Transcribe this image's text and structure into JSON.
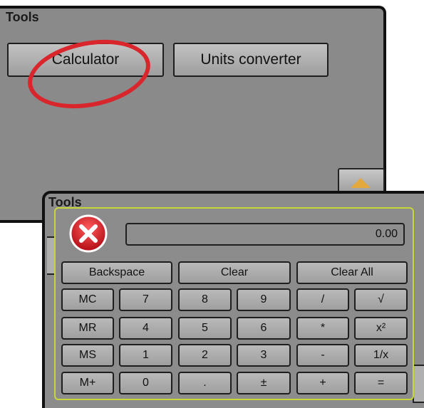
{
  "back_window": {
    "title": "Tools",
    "buttons": {
      "calculator": "Calculator",
      "units_converter": "Units converter"
    }
  },
  "front_window": {
    "title": "Tools"
  },
  "calculator": {
    "display_value": "0.00",
    "close_icon": "close-icon",
    "row0": [
      "Backspace",
      "Clear",
      "Clear All"
    ],
    "row1": [
      "MC",
      "7",
      "8",
      "9",
      "/",
      "√"
    ],
    "row2": [
      "MR",
      "4",
      "5",
      "6",
      "*",
      "x²"
    ],
    "row3": [
      "MS",
      "1",
      "2",
      "3",
      "-",
      "1/x"
    ],
    "row4": [
      "M+",
      "0",
      ".",
      "±",
      "+",
      "="
    ]
  },
  "colors": {
    "highlight_ring": "#d8262c",
    "panel_border": "#c9d63a",
    "close_icon_red": "#d9232b",
    "window_bg": "#8c8c8c"
  }
}
